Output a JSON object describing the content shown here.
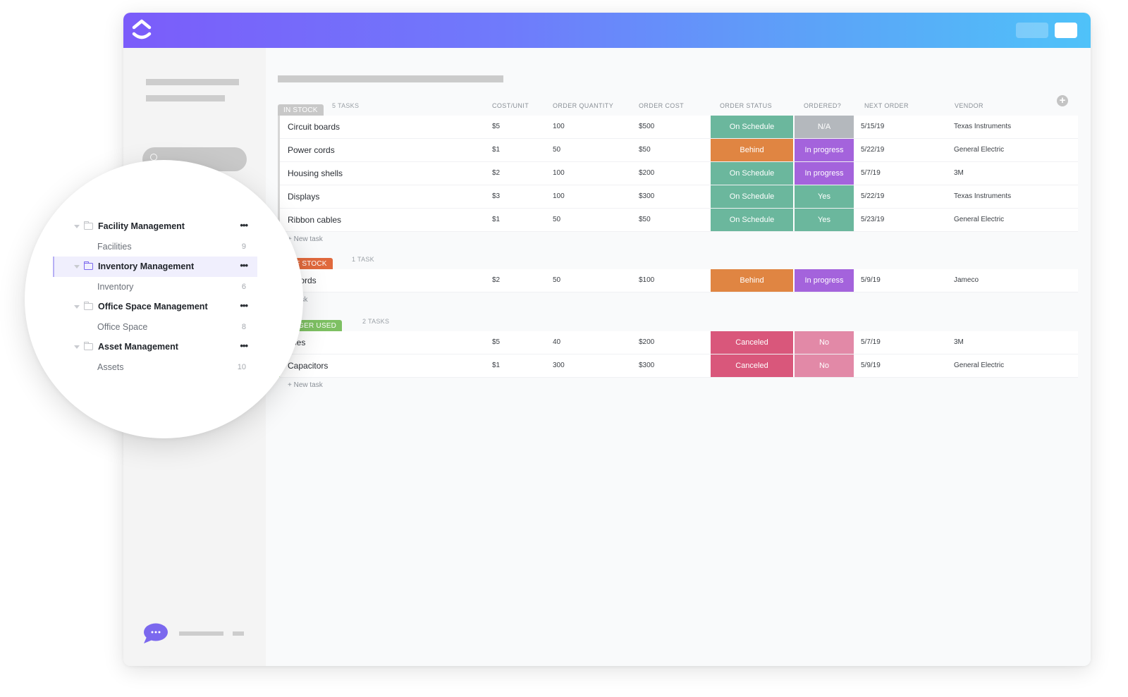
{
  "app": {
    "logo": "clickup-logo-icon",
    "colors": {
      "brand_purple": "#7b68ee",
      "topbar_gradient_start": "#7b5cfa",
      "topbar_gradient_end": "#4fc2f9",
      "on_schedule": "#6bb79d",
      "behind": "#e08542",
      "in_progress": "#a463dc",
      "na": "#b4b8bd",
      "yes": "#6bb79d",
      "canceled": "#d9577b",
      "no": "#e289a7",
      "in_stock_tag": "#c8c8c8",
      "out_of_stock_tag": "#e0693d",
      "no_longer_used_tag": "#7ec063"
    }
  },
  "table": {
    "columns": {
      "cost_unit": "COST/UNIT",
      "order_quantity": "ORDER QUANTITY",
      "order_cost": "ORDER COST",
      "order_status": "ORDER STATUS",
      "ordered": "ORDERED?",
      "next_order": "NEXT ORDER",
      "vendor": "VENDOR"
    },
    "add_column_icon": "plus-circle-icon",
    "groups": [
      {
        "tag": "IN STOCK",
        "count": "5 TASKS",
        "new_task": "+ New task",
        "rows": [
          {
            "name": "Circuit boards",
            "cost": "$5",
            "qty": "100",
            "order_cost": "$500",
            "status": "On Schedule",
            "status_color": "#6bb79d",
            "ordered": "N/A",
            "ordered_color": "#b4b8bd",
            "next": "5/15/19",
            "vendor": "Texas Instruments"
          },
          {
            "name": "Power cords",
            "cost": "$1",
            "qty": "50",
            "order_cost": "$50",
            "status": "Behind",
            "status_color": "#e08542",
            "ordered": "In progress",
            "ordered_color": "#a463dc",
            "next": "5/22/19",
            "vendor": "General Electric"
          },
          {
            "name": "Housing shells",
            "cost": "$2",
            "qty": "100",
            "order_cost": "$200",
            "status": "On Schedule",
            "status_color": "#6bb79d",
            "ordered": "In progress",
            "ordered_color": "#a463dc",
            "next": "5/7/19",
            "vendor": "3M"
          },
          {
            "name": "Displays",
            "cost": "$3",
            "qty": "100",
            "order_cost": "$300",
            "status": "On Schedule",
            "status_color": "#6bb79d",
            "ordered": "Yes",
            "ordered_color": "#6bb79d",
            "next": "5/22/19",
            "vendor": "Texas Instruments"
          },
          {
            "name": "Ribbon cables",
            "cost": "$1",
            "qty": "50",
            "order_cost": "$50",
            "status": "On Schedule",
            "status_color": "#6bb79d",
            "ordered": "Yes",
            "ordered_color": "#6bb79d",
            "next": "5/23/19",
            "vendor": "General Electric"
          }
        ]
      },
      {
        "tag": "T OF STOCK",
        "count": "1 TASK",
        "new_task": "w task",
        "rows": [
          {
            "name": "B cords",
            "cost": "$2",
            "qty": "50",
            "order_cost": "$100",
            "status": "Behind",
            "status_color": "#e08542",
            "ordered": "In progress",
            "ordered_color": "#a463dc",
            "next": "5/9/19",
            "vendor": "Jameco"
          }
        ]
      },
      {
        "tag": "LONGER USED",
        "count": "2 TASKS",
        "new_task": "+ New task",
        "rows": [
          {
            "name": "ases",
            "cost": "$5",
            "qty": "40",
            "order_cost": "$200",
            "status": "Canceled",
            "status_color": "#d9577b",
            "ordered": "No",
            "ordered_color": "#e289a7",
            "next": "5/7/19",
            "vendor": "3M"
          },
          {
            "name": "Capacitors",
            "cost": "$1",
            "qty": "300",
            "order_cost": "$300",
            "status": "Canceled",
            "status_color": "#d9577b",
            "ordered": "No",
            "ordered_color": "#e289a7",
            "next": "5/9/19",
            "vendor": "General Electric"
          }
        ]
      }
    ]
  },
  "sidebar_zoom": {
    "items": [
      {
        "type": "folder",
        "label": "Facility Management",
        "menu": "•••",
        "active": false
      },
      {
        "type": "list",
        "label": "Facilities",
        "count": "9"
      },
      {
        "type": "folder",
        "label": "Inventory Management",
        "menu": "•••",
        "active": true
      },
      {
        "type": "list",
        "label": "Inventory",
        "count": "6"
      },
      {
        "type": "folder",
        "label": "Office Space Management",
        "menu": "•••",
        "active": false
      },
      {
        "type": "list",
        "label": "Office Space",
        "count": "8"
      },
      {
        "type": "folder",
        "label": "Asset Management",
        "menu": "•••",
        "active": false
      },
      {
        "type": "list",
        "label": "Assets",
        "count": "10"
      }
    ]
  },
  "sidebar": {
    "search_icon": "search-icon",
    "chat_icon": "chat-bubble-icon"
  }
}
